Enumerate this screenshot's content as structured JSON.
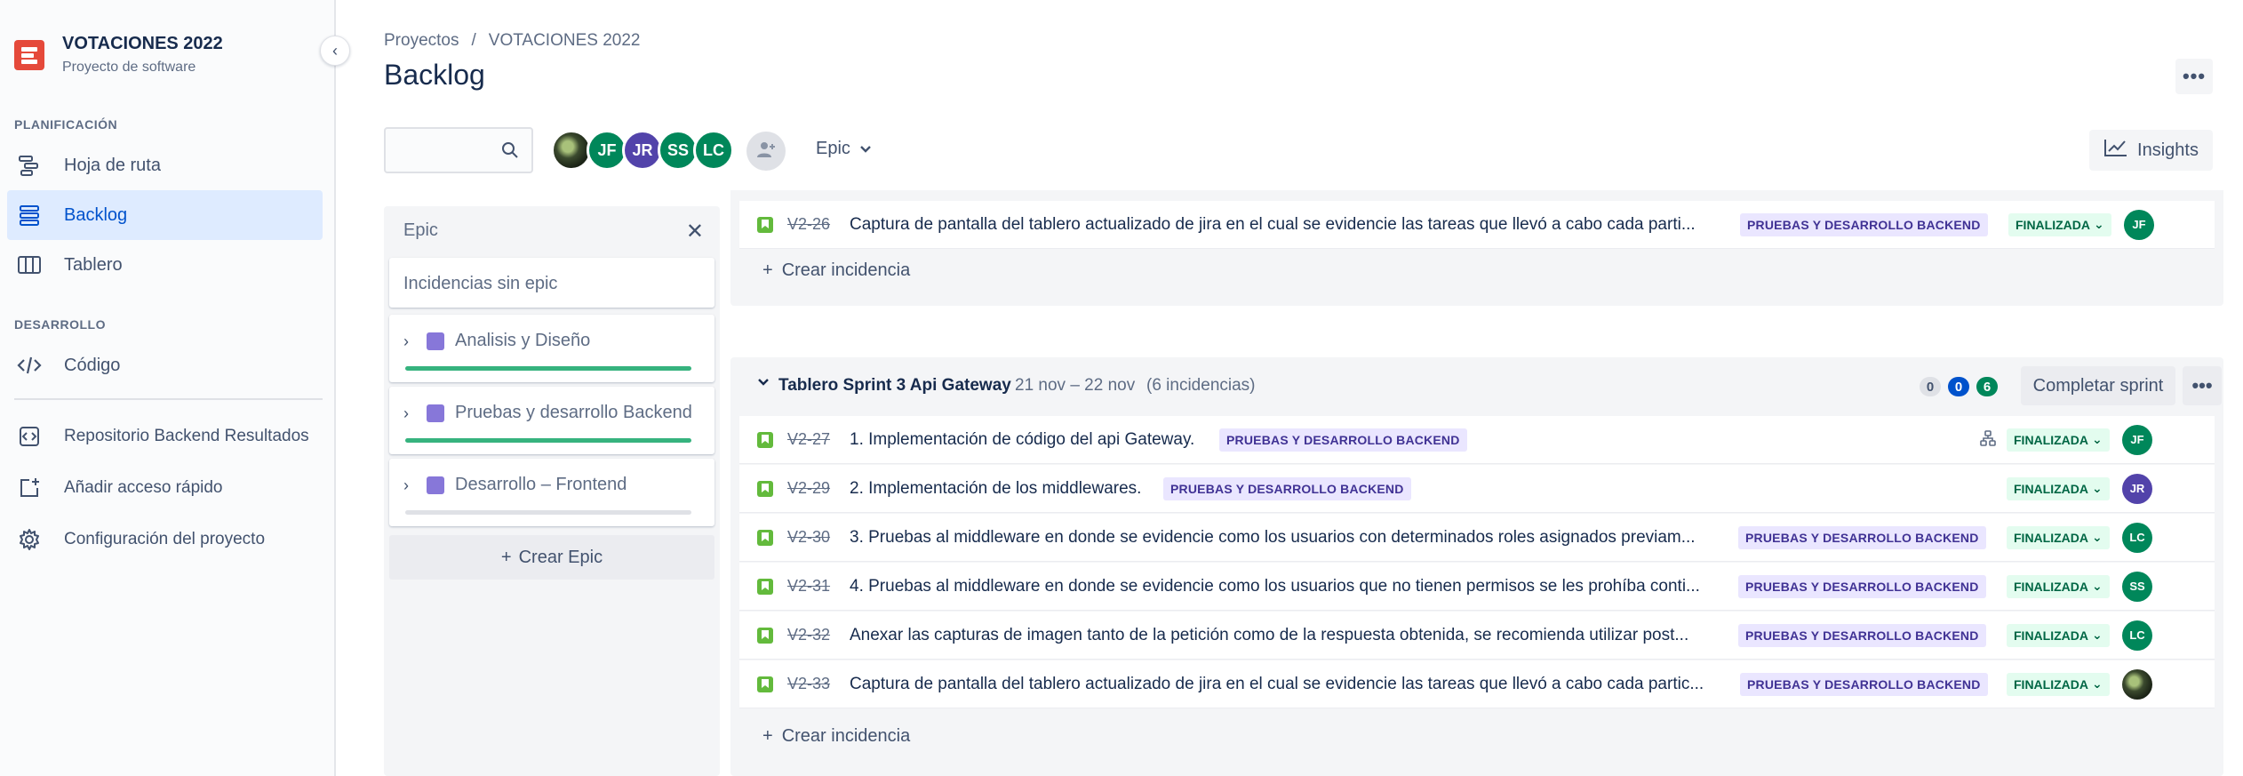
{
  "project": {
    "name": "VOTACIONES 2022",
    "type": "Proyecto de software"
  },
  "sidebar": {
    "sections": [
      {
        "title": "PLANIFICACIÓN",
        "items": [
          {
            "label": "Hoja de ruta",
            "icon": "roadmap-icon"
          },
          {
            "label": "Backlog",
            "icon": "backlog-icon",
            "active": true
          },
          {
            "label": "Tablero",
            "icon": "board-icon"
          }
        ]
      },
      {
        "title": "DESARROLLO",
        "items": [
          {
            "label": "Código",
            "icon": "code-icon"
          }
        ]
      }
    ],
    "extra": [
      {
        "label": "Repositorio Backend Resultados",
        "icon": "repository-icon"
      },
      {
        "label": "Añadir acceso rápido",
        "icon": "add-shortcut-icon"
      },
      {
        "label": "Configuración del proyecto",
        "icon": "gear-icon"
      }
    ]
  },
  "header": {
    "breadcrumb": [
      "Proyectos",
      "/",
      "VOTACIONES 2022"
    ],
    "title": "Backlog",
    "search_placeholder": "",
    "avatars": [
      {
        "initials": "",
        "color": "#2b3a24",
        "photo": true
      },
      {
        "initials": "JF",
        "color": "#00875a"
      },
      {
        "initials": "JR",
        "color": "#5243aa"
      },
      {
        "initials": "SS",
        "color": "#00875a"
      },
      {
        "initials": "LC",
        "color": "#00875a"
      }
    ],
    "epic_filter": "Epic",
    "insights": "Insights"
  },
  "epic_panel": {
    "title": "Epic",
    "no_epic": "Incidencias sin epic",
    "epics": [
      {
        "name": "Analisis y Diseño",
        "progress": 1.0
      },
      {
        "name": "Pruebas y desarrollo Backend",
        "progress": 1.0
      },
      {
        "name": "Desarrollo – Frontend",
        "progress": 0.0
      }
    ],
    "create": "Crear Epic"
  },
  "sprint1": {
    "issues": [
      {
        "key": "V2-26",
        "summary": "Captura de pantalla del tablero actualizado de jira en el cual se evidencie las tareas que llevó a cabo cada parti...",
        "epic": "PRUEBAS Y DESARROLLO BACKEND",
        "status": "FINALIZADA",
        "assignee": "JF",
        "assignee_color": "#00875a"
      }
    ],
    "create": "Crear incidencia"
  },
  "sprint2": {
    "name": "Tablero Sprint 3 Api Gateway",
    "dates": "21 nov – 22 nov",
    "count": "(6 incidencias)",
    "counts": {
      "todo": "0",
      "in_progress": "0",
      "done": "6"
    },
    "complete": "Completar sprint",
    "issues": [
      {
        "key": "V2-27",
        "summary": "1. Implementación de código del api Gateway.",
        "epic": "PRUEBAS Y DESARROLLO BACKEND",
        "status": "FINALIZADA",
        "assignee": "JF",
        "assignee_color": "#00875a",
        "has_children": true
      },
      {
        "key": "V2-29",
        "summary": "2. Implementación de los middlewares.",
        "epic": "PRUEBAS Y DESARROLLO BACKEND",
        "status": "FINALIZADA",
        "assignee": "JR",
        "assignee_color": "#5243aa"
      },
      {
        "key": "V2-30",
        "summary": "3. Pruebas al middleware en donde se evidencie como los usuarios con determinados roles asignados previam...",
        "epic": "PRUEBAS Y DESARROLLO BACKEND",
        "status": "FINALIZADA",
        "assignee": "LC",
        "assignee_color": "#00875a"
      },
      {
        "key": "V2-31",
        "summary": "4. Pruebas al middleware en donde se evidencie como los usuarios que no tienen permisos se les prohíba conti...",
        "epic": "PRUEBAS Y DESARROLLO BACKEND",
        "status": "FINALIZADA",
        "assignee": "SS",
        "assignee_color": "#00875a"
      },
      {
        "key": "V2-32",
        "summary": "Anexar las capturas de imagen tanto de la petición como de la respuesta obtenida, se recomienda utilizar post...",
        "epic": "PRUEBAS Y DESARROLLO BACKEND",
        "status": "FINALIZADA",
        "assignee": "LC",
        "assignee_color": "#00875a"
      },
      {
        "key": "V2-33",
        "summary": "Captura de pantalla del tablero actualizado de jira en el cual se evidencie las tareas que llevó a cabo cada partic...",
        "epic": "PRUEBAS Y DESARROLLO BACKEND",
        "status": "FINALIZADA",
        "assignee": "",
        "assignee_color": "#2b3a24",
        "photo": true
      }
    ],
    "create": "Crear incidencia"
  }
}
